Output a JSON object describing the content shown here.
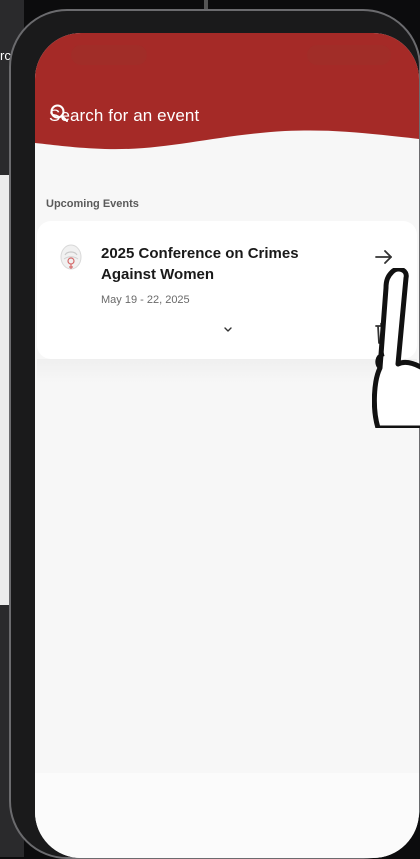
{
  "background": {
    "partial_text": "rc"
  },
  "header": {
    "brand_color": "#a52a27",
    "search": {
      "icon": "search-icon",
      "placeholder": "Search for an event"
    }
  },
  "upcoming": {
    "section_label": "Upcoming Events",
    "events": [
      {
        "title": "2025 Conference on Crimes Against Women",
        "dates": "May 19 - 22, 2025",
        "logo_icon": "conference-logo-icon",
        "open_icon": "arrow-right-icon",
        "expand_icon": "chevron-down-icon",
        "delete_icon": "trash-icon"
      }
    ]
  }
}
